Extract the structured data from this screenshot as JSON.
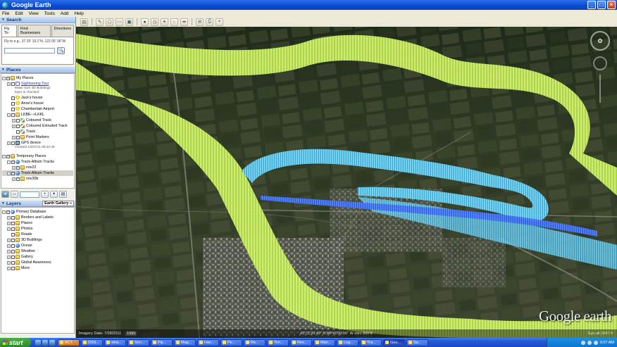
{
  "window": {
    "title": "Google Earth",
    "buttons": [
      "_",
      "□",
      "×"
    ]
  },
  "menu": [
    "File",
    "Edit",
    "View",
    "Tools",
    "Add",
    "Help"
  ],
  "toolbar": {
    "icons": [
      "sidebar-toggle-icon",
      "placemark-icon",
      "polygon-icon",
      "path-icon",
      "overlay-icon",
      "record-tour-icon",
      "historical-imagery-icon",
      "sun-icon",
      "planets-icon",
      "ruler-icon",
      "email-icon",
      "print-icon",
      "view-in-maps-icon"
    ]
  },
  "search": {
    "header": "Search",
    "tabs": [
      "Fly To",
      "Find Businesses",
      "Directions"
    ],
    "fly_label": "Fly to e.g., 37 25' 19.1\"N, 122 05' 06\"W",
    "fly_value": "",
    "go": "🔍"
  },
  "places": {
    "header": "Places",
    "items": [
      {
        "label": "My Places",
        "level": 0,
        "exp": "−",
        "checked": true,
        "icon": "ico-folder"
      },
      {
        "label": "Sightseeing Tour",
        "level": 1,
        "exp": "+",
        "checked": false,
        "icon": "ico-tour",
        "link": true
      },
      {
        "note": "Make sure 3D Buildings",
        "level": 2
      },
      {
        "note": "layer is checked",
        "level": 2
      },
      {
        "label": "Jack's house",
        "level": 1,
        "exp": "",
        "checked": false,
        "icon": "ico-pin"
      },
      {
        "label": "Anne's house",
        "level": 1,
        "exp": "",
        "checked": false,
        "icon": "ico-pin"
      },
      {
        "label": "Chamberlain Airport",
        "level": 1,
        "exp": "",
        "checked": false,
        "icon": "ico-pin"
      },
      {
        "label": "LKBE-->LKKL",
        "level": 1,
        "exp": "−",
        "checked": false,
        "icon": "ico-folder"
      },
      {
        "label": "Coloured Track",
        "level": 2,
        "exp": "+",
        "checked": false,
        "icon": "ico-track"
      },
      {
        "label": "Coloured Extruded Track",
        "level": 2,
        "exp": "+",
        "checked": false,
        "icon": "ico-track"
      },
      {
        "label": "Track",
        "level": 2,
        "exp": "",
        "checked": false,
        "icon": "ico-track"
      },
      {
        "label": "Point Markers",
        "level": 2,
        "exp": "+",
        "checked": false,
        "icon": "ico-folder"
      },
      {
        "label": "GPS device",
        "level": 1,
        "exp": "+",
        "checked": false,
        "icon": "ico-gps"
      },
      {
        "note": "Created 10/07/11 09:34:48",
        "level": 2
      },
      {
        "spacer": true
      },
      {
        "label": "Temporary Places",
        "level": 0,
        "exp": "−",
        "checked": true,
        "icon": "ico-folder"
      },
      {
        "label": "Track-Album Tracks",
        "level": 1,
        "exp": "−",
        "checked": true,
        "icon": "ico-globe"
      },
      {
        "label": "nov22",
        "level": 2,
        "exp": "+",
        "checked": true,
        "icon": "ico-folder"
      },
      {
        "label": "Track-Album Tracks",
        "level": 1,
        "exp": "−",
        "checked": true,
        "icon": "ico-globe",
        "sel": true
      },
      {
        "label": "nov30b",
        "level": 2,
        "exp": "+",
        "checked": true,
        "icon": "ico-folder"
      }
    ],
    "tool_icons": [
      "search-places-icon",
      "up-icon",
      "down-icon",
      "add-icon"
    ]
  },
  "layers": {
    "header": "Layers",
    "gallery": "Earth Gallery »",
    "items": [
      {
        "label": "Primary Database",
        "level": 0,
        "exp": "−",
        "checked": true,
        "icon": "ico-globe"
      },
      {
        "label": "Borders and Labels",
        "level": 1,
        "exp": "+",
        "checked": false,
        "icon": "ico-folder"
      },
      {
        "label": "Places",
        "level": 1,
        "exp": "+",
        "checked": false,
        "icon": "ico-folder"
      },
      {
        "label": "Photos",
        "level": 1,
        "exp": "+",
        "checked": false,
        "icon": "ico-folder"
      },
      {
        "label": "Roads",
        "level": 1,
        "exp": "",
        "checked": false,
        "icon": "ico-folder"
      },
      {
        "label": "3D Buildings",
        "level": 1,
        "exp": "+",
        "checked": false,
        "icon": "ico-folder"
      },
      {
        "label": "Ocean",
        "level": 1,
        "exp": "+",
        "checked": false,
        "icon": "ico-globe"
      },
      {
        "label": "Weather",
        "level": 1,
        "exp": "+",
        "checked": false,
        "icon": "ico-folder"
      },
      {
        "label": "Gallery",
        "level": 1,
        "exp": "+",
        "checked": false,
        "icon": "ico-folder"
      },
      {
        "label": "Global Awareness",
        "level": 1,
        "exp": "+",
        "checked": false,
        "icon": "ico-folder"
      },
      {
        "label": "More",
        "level": 1,
        "exp": "+",
        "checked": false,
        "icon": "ico-folder"
      }
    ]
  },
  "map": {
    "logo": "Google earth",
    "imagery_date": "Imagery Date: 7/28/2011",
    "year": "1990",
    "coords": "43°11'20.49\" N   88°41'00.00\" W   elev  869 ft",
    "eye_alt": "Eye alt   2647 ft"
  },
  "taskbar": {
    "start": "start",
    "tasks": [
      {
        "label": "ACT",
        "style": "orange"
      },
      {
        "label": "DSS...",
        "style": ""
      },
      {
        "label": "wha...",
        "style": ""
      },
      {
        "label": "Sen...",
        "style": ""
      },
      {
        "label": "Pip...",
        "style": ""
      },
      {
        "label": "Mag...",
        "style": ""
      },
      {
        "label": "Han...",
        "style": ""
      },
      {
        "label": "Pe...",
        "style": ""
      },
      {
        "label": "Re...",
        "style": ""
      },
      {
        "label": "Tim...",
        "style": ""
      },
      {
        "label": "Res...",
        "style": ""
      },
      {
        "label": "Man...",
        "style": ""
      },
      {
        "label": "Log...",
        "style": ""
      },
      {
        "label": "Tra...",
        "style": ""
      },
      {
        "label": "Goo...",
        "style": "active"
      },
      {
        "label": "Sa...",
        "style": ""
      }
    ],
    "clock": "9:07 AM"
  },
  "colors": {
    "xp_blue": "#0a4ad0",
    "track_yellow": "#c8f060",
    "track_cyan": "#4cc8f0",
    "track_blue": "#2a5ce8"
  }
}
